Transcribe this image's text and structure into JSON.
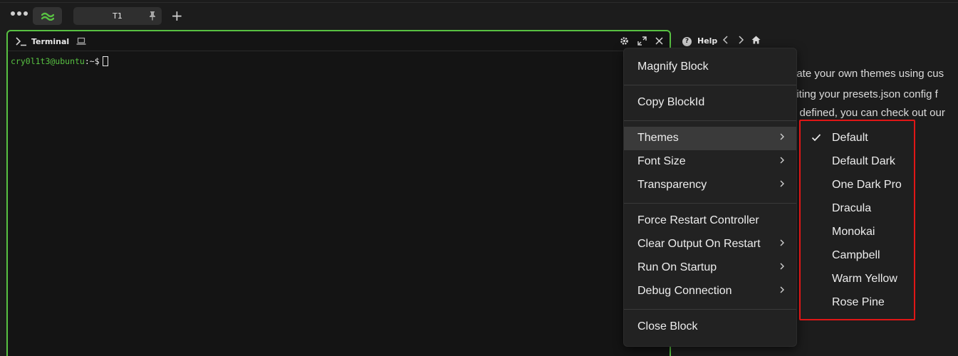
{
  "topbar": {
    "tab_name": "T1",
    "add_tab": "+"
  },
  "terminal": {
    "title": "Terminal",
    "prompt_user": "cry0l1t3@ubuntu",
    "prompt_path": ":~$"
  },
  "help": {
    "title": "Help",
    "icon_glyph": "?",
    "lines": [
      "eate your own themes using cus",
      "diting your presets.json config f",
      "e defined, you can check out our"
    ]
  },
  "context_menu": {
    "items": [
      {
        "label": "Magnify Block",
        "submenu": false
      },
      {
        "label": "Copy BlockId",
        "submenu": false
      },
      {
        "label": "Themes",
        "submenu": true
      },
      {
        "label": "Font Size",
        "submenu": true
      },
      {
        "label": "Transparency",
        "submenu": true
      },
      {
        "label": "Force Restart Controller",
        "submenu": false
      },
      {
        "label": "Clear Output On Restart",
        "submenu": true
      },
      {
        "label": "Run On Startup",
        "submenu": true
      },
      {
        "label": "Debug Connection",
        "submenu": true
      },
      {
        "label": "Close Block",
        "submenu": false
      }
    ],
    "active_item": "Themes"
  },
  "themes_submenu": {
    "selected": "Default",
    "items": [
      "Default",
      "Default Dark",
      "One Dark Pro",
      "Dracula",
      "Monokai",
      "Campbell",
      "Warm Yellow",
      "Rose Pine"
    ]
  },
  "colors": {
    "accent_green": "#58c142",
    "highlight_red": "#e01616",
    "menu_bg": "#222222"
  },
  "icons": [
    "menu-dots-icon",
    "workspace-wave-icon",
    "pin-icon",
    "plus-icon",
    "terminal-prompt-icon",
    "laptop-icon",
    "gear-icon",
    "expand-icon",
    "close-icon",
    "help-circle-icon",
    "chevron-left-icon",
    "chevron-right-icon",
    "home-icon",
    "checkmark-icon"
  ]
}
